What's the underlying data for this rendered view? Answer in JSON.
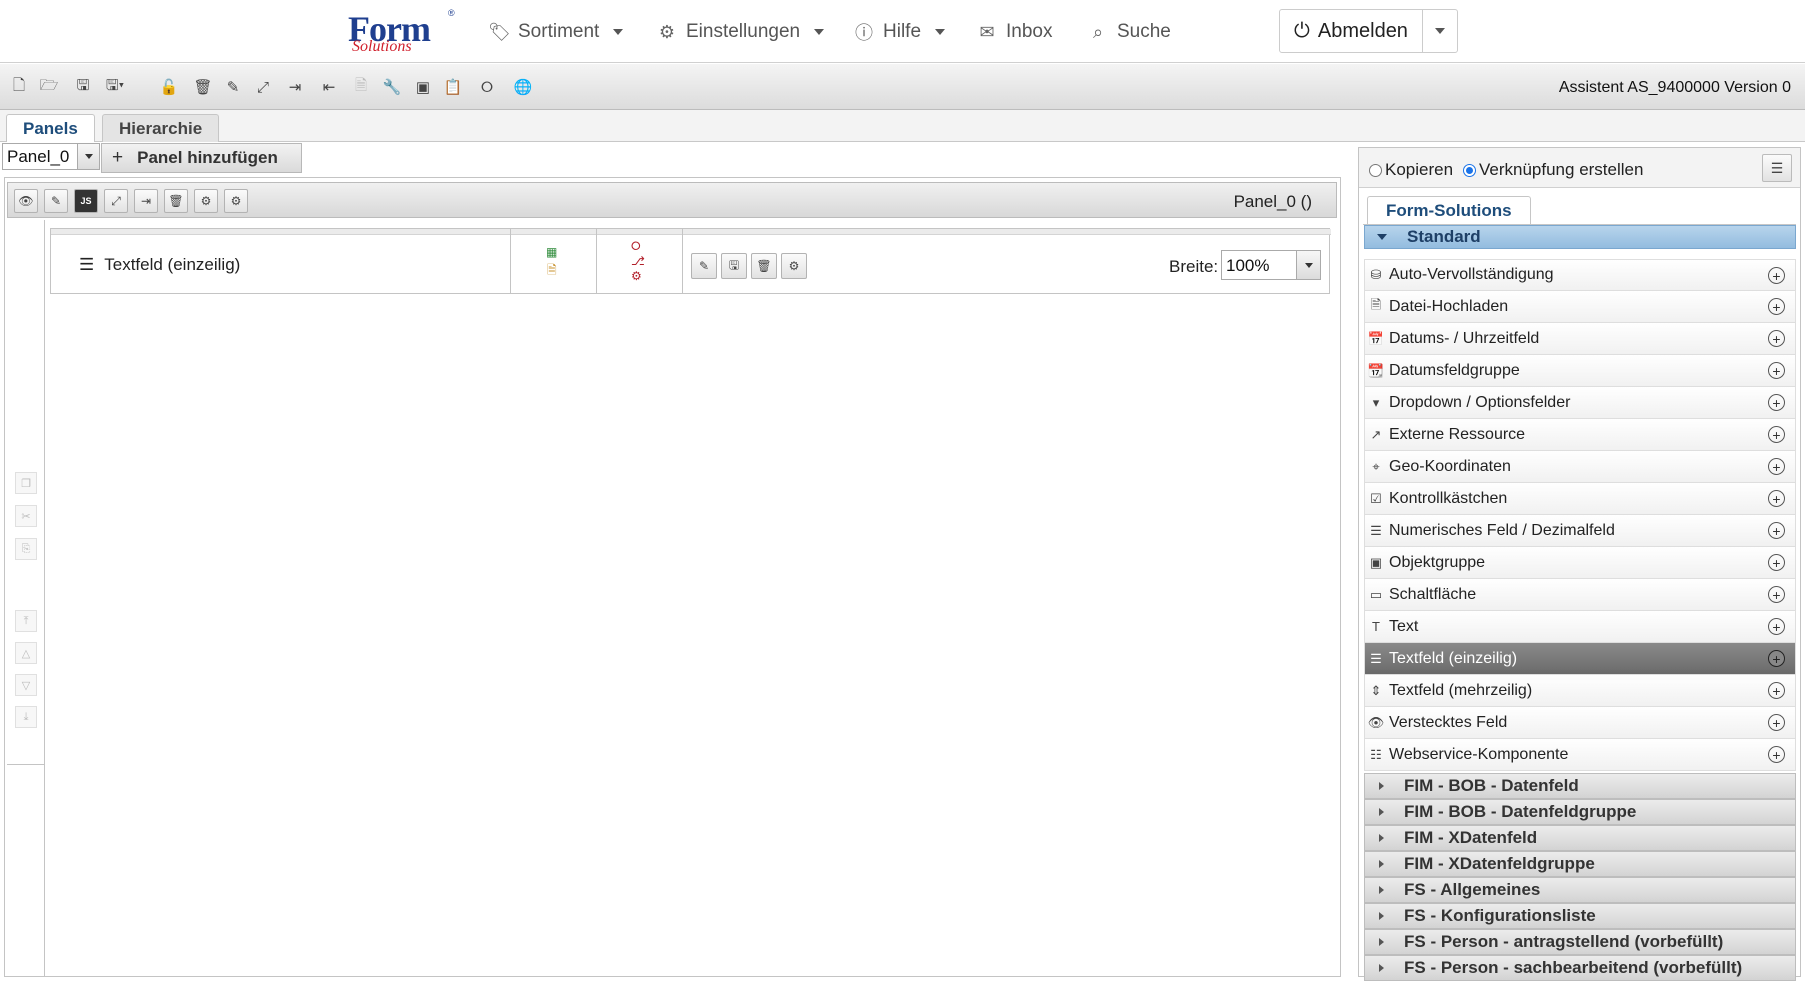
{
  "nav": {
    "logo_main": "Form",
    "logo_sub": "Solutions",
    "logo_reg": "®",
    "items": [
      {
        "label": "Sortiment",
        "icon": "tag-icon"
      },
      {
        "label": "Einstellungen",
        "icon": "gear-icon"
      },
      {
        "label": "Hilfe",
        "icon": "help-circle-icon"
      },
      {
        "label": "Inbox",
        "icon": "envelope-icon"
      },
      {
        "label": "Suche",
        "icon": "search-icon"
      }
    ],
    "logout_label": "Abmelden"
  },
  "toolbar": {
    "assistent": "Assistent AS_9400000 Version 0"
  },
  "tabs": {
    "panels": "Panels",
    "hierarchie": "Hierarchie"
  },
  "panel_select": {
    "value": "Panel_0",
    "add_label": "Panel hinzufügen"
  },
  "editor": {
    "title": "Panel_0 ()",
    "field": {
      "label": "Textfeld (einzeilig)",
      "width_label": "Breite:",
      "width_value": "100%"
    }
  },
  "right_panel": {
    "radio_copy": "Kopieren",
    "radio_link": "Verknüpfung erstellen",
    "selected_radio": "link",
    "tab": "Form-Solutions",
    "open_group": "Standard",
    "items": [
      {
        "label": "Auto-Vervollständigung",
        "icon": "database-icon"
      },
      {
        "label": "Datei-Hochladen",
        "icon": "file-upload-icon"
      },
      {
        "label": "Datums- / Uhrzeitfeld",
        "icon": "calendar-icon"
      },
      {
        "label": "Datumsfeldgruppe",
        "icon": "calendar-group-icon"
      },
      {
        "label": "Dropdown / Optionsfelder",
        "icon": "dropdown-icon"
      },
      {
        "label": "Externe Ressource",
        "icon": "external-link-icon"
      },
      {
        "label": "Geo-Koordinaten",
        "icon": "map-pin-icon"
      },
      {
        "label": "Kontrollkästchen",
        "icon": "checkbox-icon"
      },
      {
        "label": "Numerisches Feld / Dezimalfeld",
        "icon": "numbered-list-icon"
      },
      {
        "label": "Objektgruppe",
        "icon": "object-group-icon"
      },
      {
        "label": "Schaltfläche",
        "icon": "button-icon"
      },
      {
        "label": "Text",
        "icon": "text-icon"
      },
      {
        "label": "Textfeld (einzeilig)",
        "icon": "lines-icon"
      },
      {
        "label": "Textfeld (mehrzeilig)",
        "icon": "multiline-icon"
      },
      {
        "label": "Verstecktes Feld",
        "icon": "eye-slash-icon"
      },
      {
        "label": "Webservice-Komponente",
        "icon": "sitemap-icon"
      }
    ],
    "selected_item_index": 12,
    "groups": [
      "FIM - BOB - Datenfeld",
      "FIM - BOB - Datenfeldgruppe",
      "FIM - XDatenfeld",
      "FIM - XDatenfeldgruppe",
      "FS - Allgemeines",
      "FS - Konfigurationsliste",
      "FS - Person - antragstellend (vorbefüllt)",
      "FS - Person - sachbearbeitend (vorbefüllt)"
    ]
  }
}
